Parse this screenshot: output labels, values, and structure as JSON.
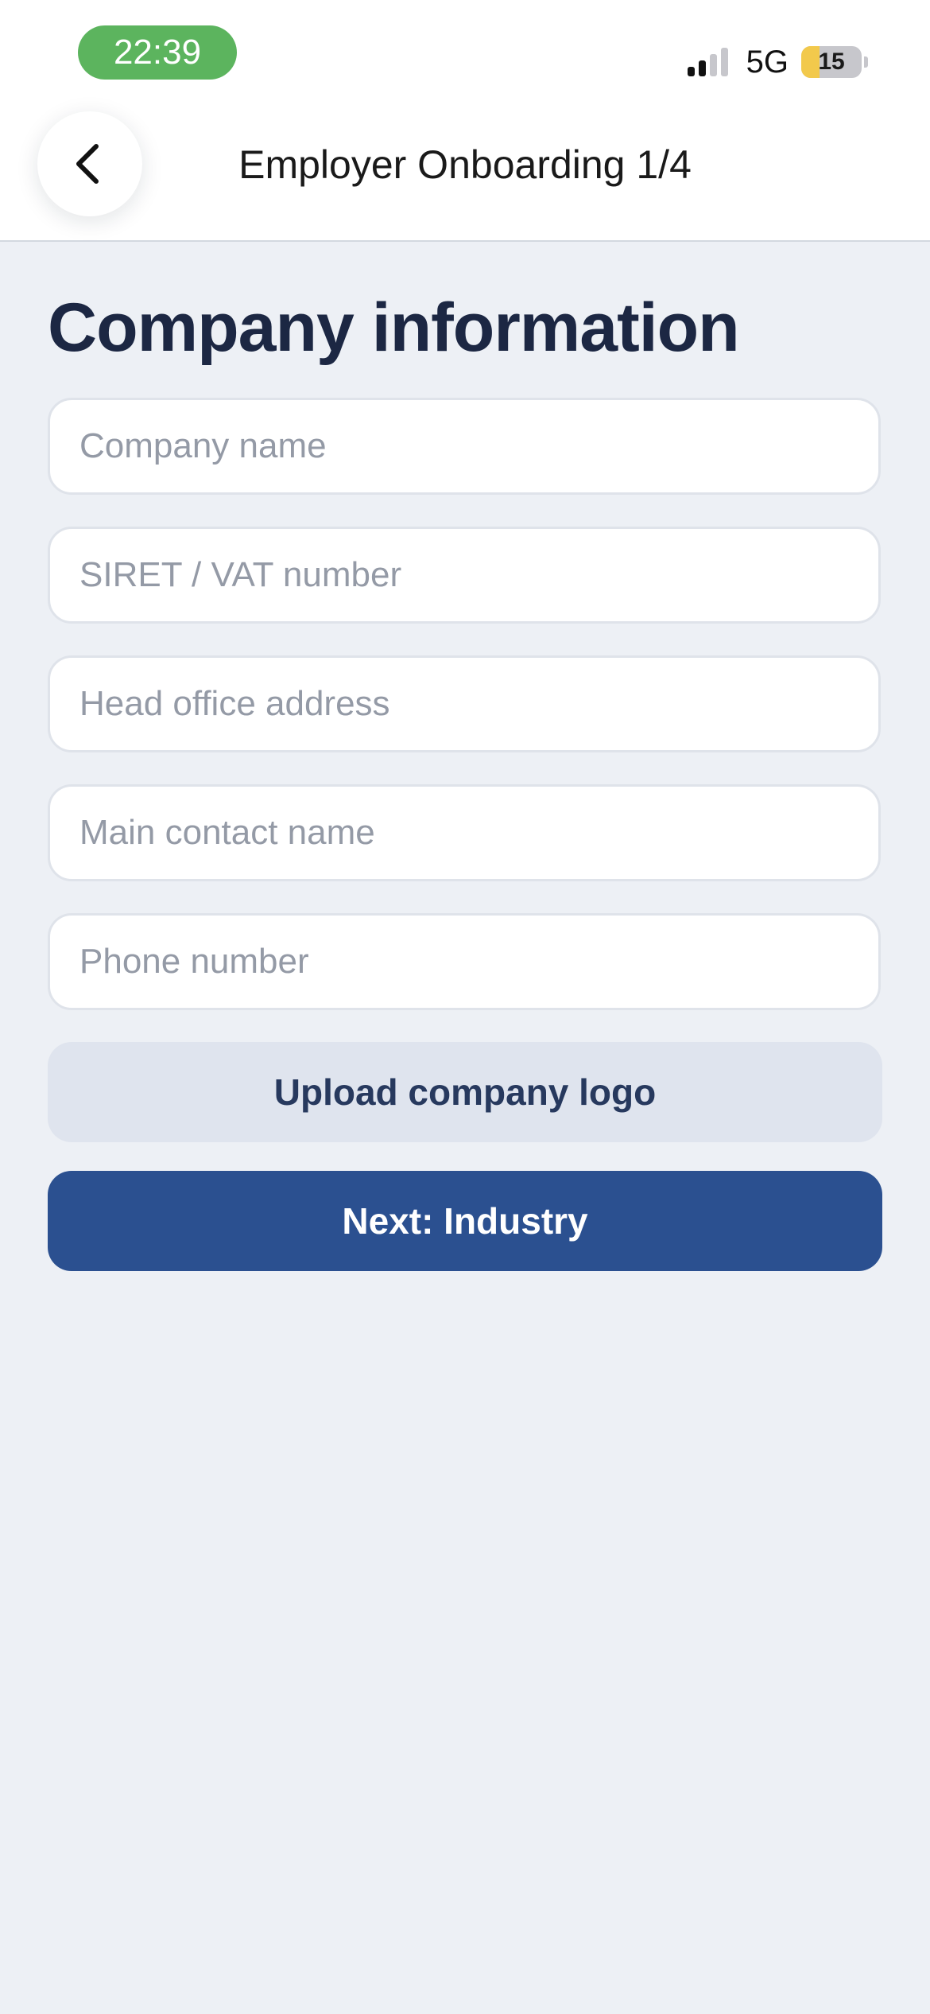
{
  "status_bar": {
    "time": "22:39",
    "network": "5G",
    "battery_level": "15",
    "battery_fraction": 0.3,
    "time_pill_color": "#5cb45e",
    "battery_color": "#f2c94c",
    "signal_bars_active": 2,
    "signal_bars_total": 4
  },
  "nav": {
    "back_icon": "chevron-left-icon",
    "title": "Employer Onboarding 1/4"
  },
  "form": {
    "heading": "Company information",
    "fields": [
      {
        "placeholder": "Company name",
        "value": ""
      },
      {
        "placeholder": "SIRET / VAT number",
        "value": ""
      },
      {
        "placeholder": "Head office address",
        "value": ""
      },
      {
        "placeholder": "Main contact name",
        "value": ""
      },
      {
        "placeholder": "Phone number",
        "value": ""
      }
    ],
    "upload_label": "Upload company logo",
    "next_label": "Next: Industry"
  },
  "colors": {
    "page_background": "#edf0f5",
    "heading": "#1c2743",
    "primary_button": "#2b5090",
    "secondary_button": "#dfe4ee"
  }
}
